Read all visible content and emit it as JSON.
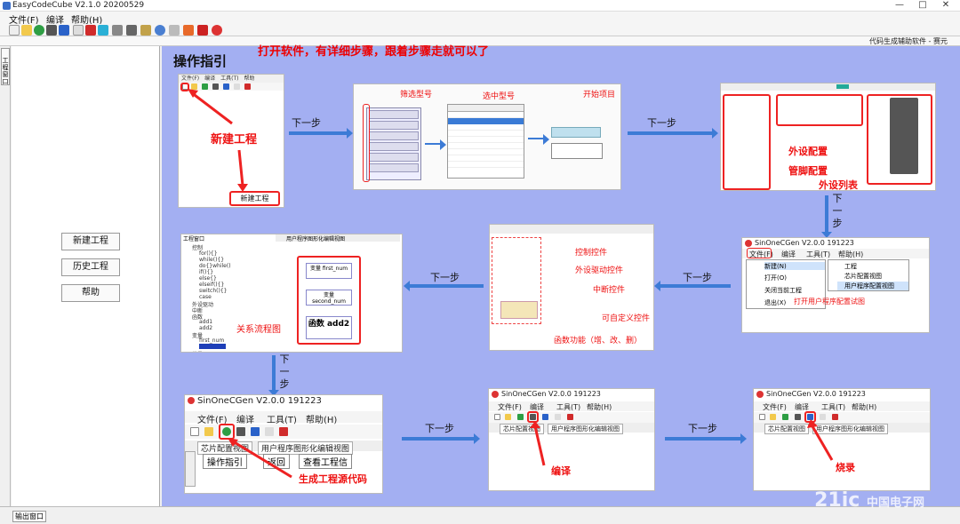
{
  "window": {
    "title": "EasyCodeCube V2.1.0 20200529",
    "controls": [
      "—",
      "□",
      "✕"
    ]
  },
  "menu": {
    "file": "文件(F)",
    "compile": "编译",
    "help": "帮助(H)"
  },
  "subbar": {
    "right_text": "代码生成辅助软件 - 赛元"
  },
  "left_strip": {
    "tab": "工程窗口"
  },
  "sidebar": {
    "buttons": [
      "新建工程",
      "历史工程",
      "帮助"
    ]
  },
  "guide": {
    "title": "操作指引",
    "banner": "打开软件，有详细步骤，跟着步骤走就可以了",
    "next_step": "下一步",
    "labels": {
      "new_project_big": "新建工程",
      "new_project_btn": "新建工程",
      "filter_model": "筛选型号",
      "select_model": "选中型号",
      "start_project": "开始项目",
      "peripheral_config": "外设配置",
      "pin_config": "管脚配置",
      "peripheral_list": "外设列表",
      "flowchart": "关系流程图",
      "control_widget": "控制控件",
      "peripheral_driver": "外设驱动控件",
      "interrupt_widget": "中断控件",
      "custom_widget": "可自定义控件",
      "function_ops": "函数功能（增、改、删）",
      "open_user_view": "打开用户程序配置试图",
      "gen_source": "生成工程源代码",
      "compile": "编译",
      "burn": "烧录"
    },
    "sincgen": {
      "title": "SinOneCGen V2.0.0 191223",
      "menu": [
        "文件(F)",
        "编译",
        "工具(T)",
        "帮助(H)"
      ],
      "tabs": [
        "芯片配置视图",
        "用户程序图形化编辑视图"
      ],
      "dropdown": [
        "新建(N)",
        "打开(O)",
        "关闭当前工程",
        "退出(X)"
      ],
      "submenu": [
        "工程",
        "芯片配置视图",
        "用户程序配置视图"
      ],
      "buttons": [
        "操作指引",
        "返回",
        "查看工程信"
      ]
    },
    "tree_items": [
      "控制",
      "for(){}",
      "while(){}",
      "do{}while()",
      "if(){}",
      "else{}",
      "elseif(){}",
      "switch(){}",
      "case",
      "外设驱动",
      "中断",
      "函数",
      "add1",
      "add2",
      "变量",
      "first_num",
      "常量"
    ],
    "flow_nodes": [
      "变量 first_num",
      "变量 second_num",
      "函数 add2"
    ],
    "window_label": "工程窗口"
  },
  "status": {
    "output_tab": "输出窗口"
  },
  "watermark": {
    "text": "21ic",
    "sub": "中国电子网"
  }
}
